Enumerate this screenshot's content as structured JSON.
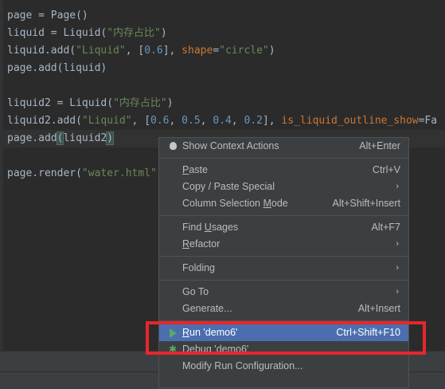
{
  "editor": {
    "lines": [
      {
        "parts": [
          {
            "t": "page = Page()",
            "c": ""
          }
        ]
      },
      {
        "parts": [
          {
            "t": "liquid = Liquid(",
            "c": ""
          },
          {
            "t": "\"内存占比\"",
            "c": "tk-str"
          },
          {
            "t": ")",
            "c": ""
          }
        ]
      },
      {
        "parts": [
          {
            "t": "liquid.add(",
            "c": ""
          },
          {
            "t": "\"Liquid\"",
            "c": "tk-str"
          },
          {
            "t": ", [",
            "c": ""
          },
          {
            "t": "0.6",
            "c": "tk-num"
          },
          {
            "t": "], ",
            "c": ""
          },
          {
            "t": "shape",
            "c": "tk-param"
          },
          {
            "t": "=",
            "c": ""
          },
          {
            "t": "\"circle\"",
            "c": "tk-str"
          },
          {
            "t": ")",
            "c": ""
          }
        ]
      },
      {
        "parts": [
          {
            "t": "page.add(liquid)",
            "c": ""
          }
        ]
      },
      {
        "parts": [
          {
            "t": "",
            "c": ""
          }
        ]
      },
      {
        "parts": [
          {
            "t": "liquid2 = Liquid(",
            "c": ""
          },
          {
            "t": "\"内存占比\"",
            "c": "tk-str"
          },
          {
            "t": ")",
            "c": ""
          }
        ]
      },
      {
        "parts": [
          {
            "t": "liquid2.add(",
            "c": ""
          },
          {
            "t": "\"Liquid\"",
            "c": "tk-str"
          },
          {
            "t": ", [",
            "c": ""
          },
          {
            "t": "0.6",
            "c": "tk-num"
          },
          {
            "t": ", ",
            "c": ""
          },
          {
            "t": "0.5",
            "c": "tk-num"
          },
          {
            "t": ", ",
            "c": ""
          },
          {
            "t": "0.4",
            "c": "tk-num"
          },
          {
            "t": ", ",
            "c": ""
          },
          {
            "t": "0.2",
            "c": "tk-num"
          },
          {
            "t": "], ",
            "c": ""
          },
          {
            "t": "is_liquid_outline_show",
            "c": "tk-param"
          },
          {
            "t": "=Fa",
            "c": ""
          }
        ]
      },
      {
        "parts": [
          {
            "t": "page.add",
            "c": ""
          },
          {
            "t": "(",
            "c": "tk-brace"
          },
          {
            "t": "liquid2",
            "c": ""
          },
          {
            "t": ")",
            "c": "tk-brace"
          }
        ],
        "caret": true
      },
      {
        "parts": [
          {
            "t": "",
            "c": ""
          }
        ]
      },
      {
        "parts": [
          {
            "t": "page.render(",
            "c": ""
          },
          {
            "t": "\"water.html\"",
            "c": "tk-str"
          },
          {
            "t": ")",
            "c": ""
          }
        ]
      }
    ]
  },
  "context_menu": {
    "show_context_actions": {
      "label": "Show Context Actions",
      "shortcut": "Alt+Enter",
      "icon": "bulb-icon"
    },
    "paste": {
      "label_mnemonic": "P",
      "label_rest": "aste",
      "shortcut": "Ctrl+V"
    },
    "copy_paste_special": {
      "label": "Copy / Paste Special",
      "arrow": "›"
    },
    "column_selection_mode": {
      "label_pre": "Column Selection ",
      "label_mnemonic": "M",
      "label_post": "ode",
      "shortcut": "Alt+Shift+Insert"
    },
    "find_usages": {
      "label_pre": "Find ",
      "label_mnemonic": "U",
      "label_post": "sages",
      "shortcut": "Alt+F7"
    },
    "refactor": {
      "label_mnemonic": "R",
      "label_rest": "efactor",
      "arrow": "›"
    },
    "folding": {
      "label": "Folding",
      "arrow": "›"
    },
    "go_to": {
      "label": "Go To",
      "arrow": "›"
    },
    "generate": {
      "label": "Generate...",
      "shortcut": "Alt+Insert"
    },
    "run": {
      "label_mnemonic": "R",
      "label_rest": "un 'demo6'",
      "shortcut": "Ctrl+Shift+F10",
      "icon": "run-play-icon"
    },
    "debug": {
      "label_mnemonic": "D",
      "label_rest": "ebug 'demo6'",
      "icon": "debug-bug-icon"
    },
    "modify_run_configuration": {
      "label": "Modify Run Configuration..."
    }
  },
  "colors": {
    "highlight_box": "#e8262c",
    "selection": "#4b6eaf",
    "run_icon": "#59a869"
  }
}
